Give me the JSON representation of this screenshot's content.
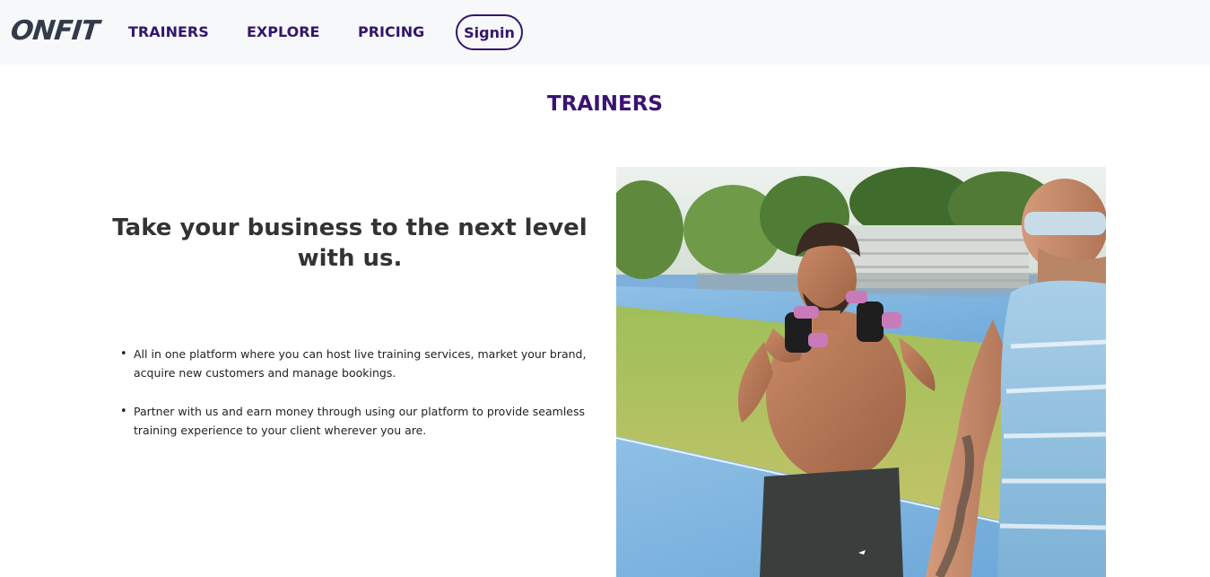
{
  "brand": {
    "logo_text": "ONFIT"
  },
  "nav": {
    "items": [
      {
        "label": "TRAINERS"
      },
      {
        "label": "EXPLORE"
      },
      {
        "label": "PRICING"
      }
    ],
    "signin_label": "Signin"
  },
  "section": {
    "title": "TRAINERS"
  },
  "hero": {
    "headline": "Take your business to the next level with us.",
    "bullets": [
      "All in one platform where you can host live training services, market your brand, acquire new customers and manage bookings.",
      "Partner with us and earn money through using our platform to provide seamless training experience to your client wherever you are."
    ]
  },
  "colors": {
    "brand_purple": "#34166b",
    "title_purple": "#3a1472",
    "nav_bg": "#f7f8fa",
    "text_dark": "#333333"
  }
}
